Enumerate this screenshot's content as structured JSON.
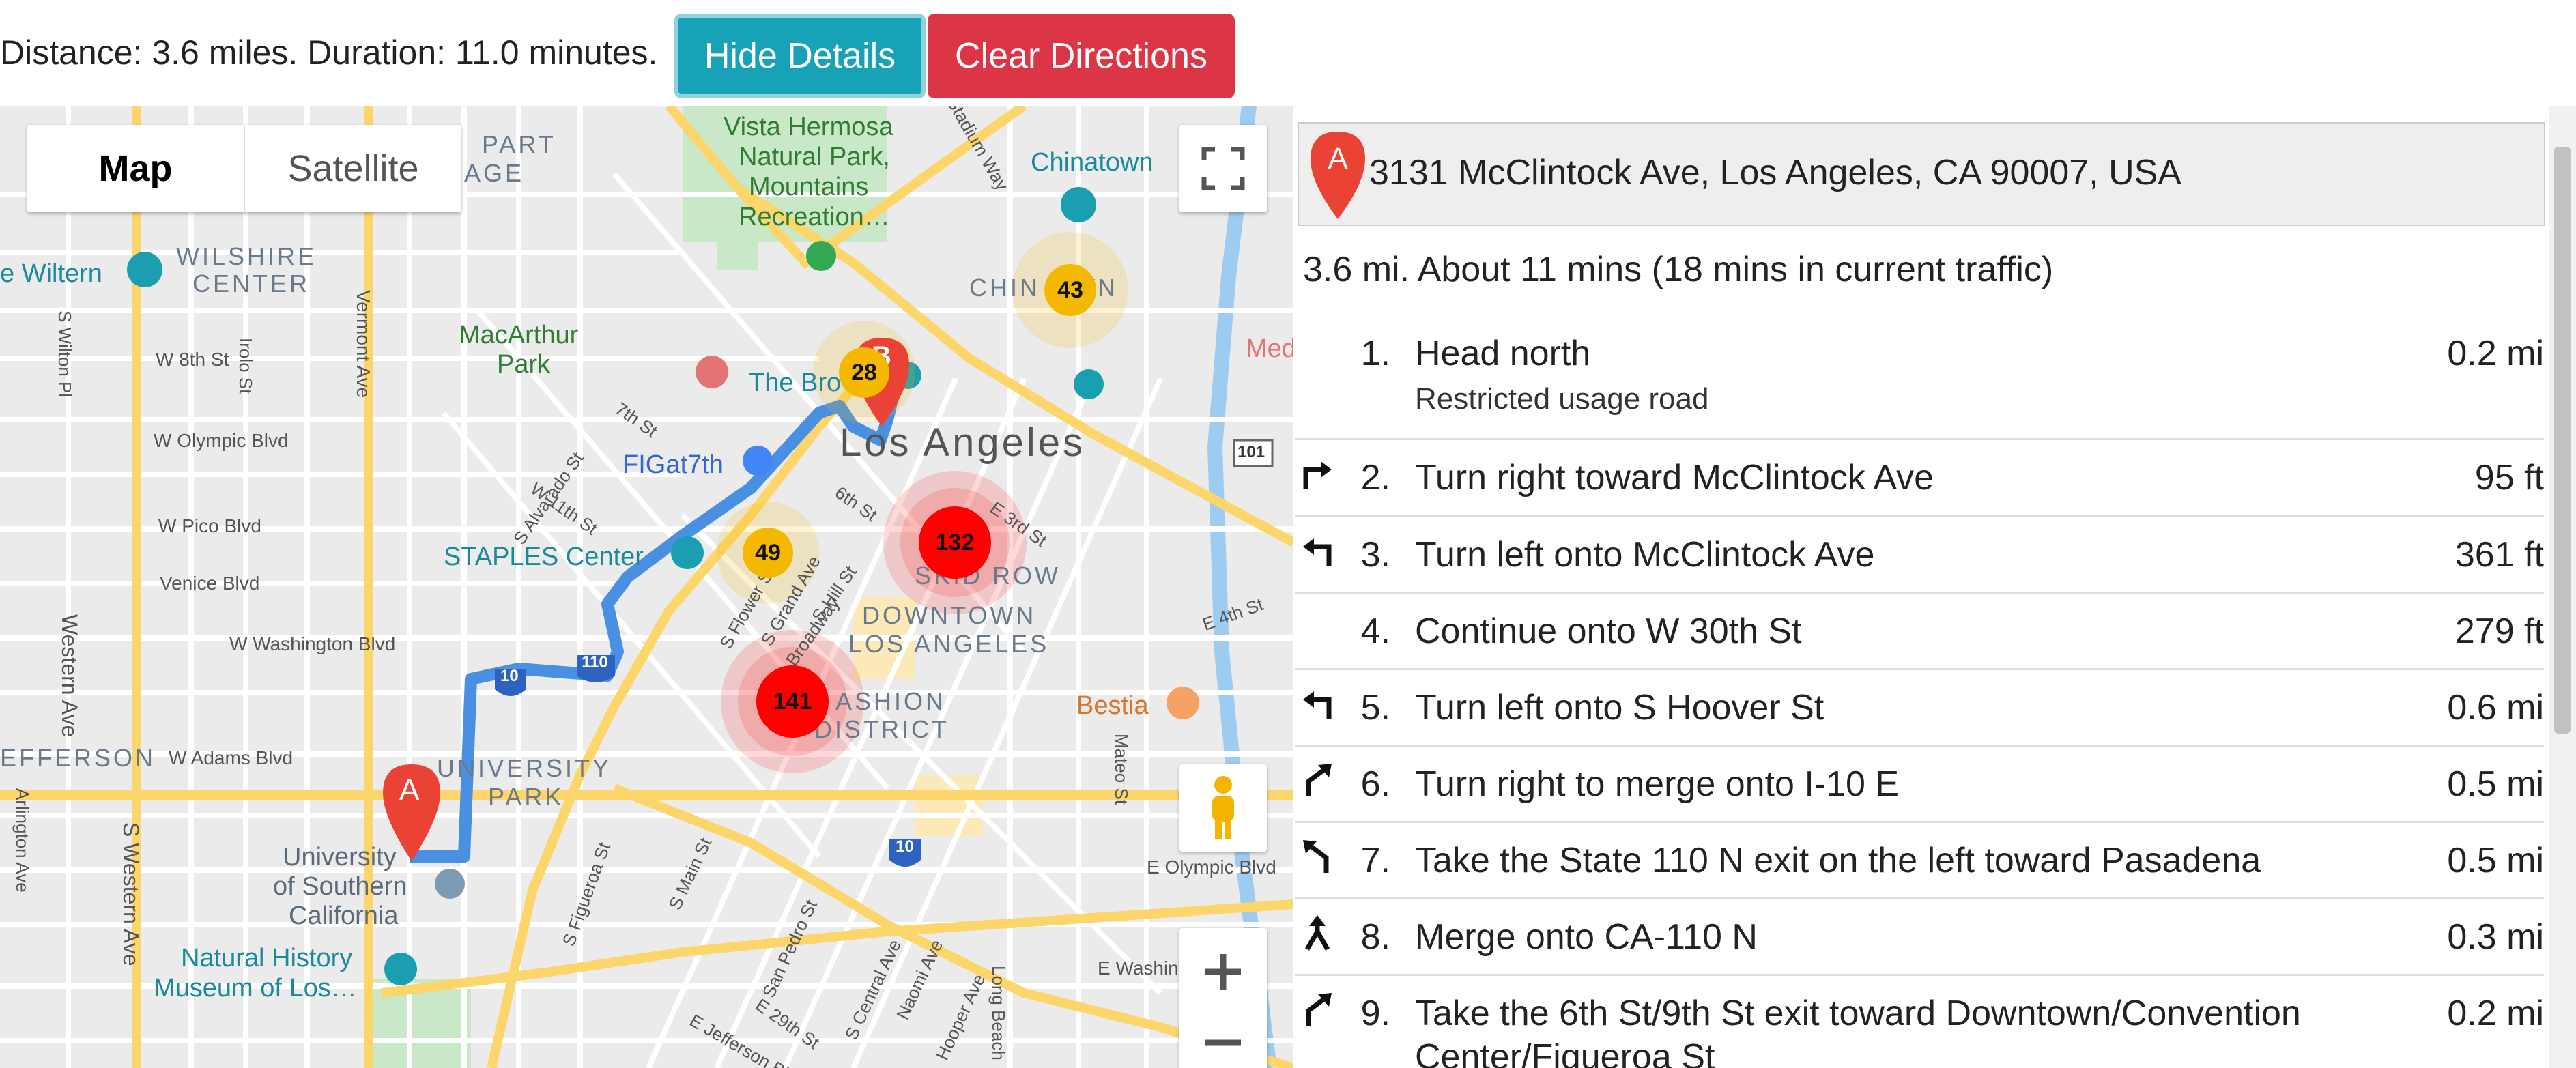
{
  "topbar": {
    "distance_text": "Distance: 3.6 miles. Duration: 11.0 minutes.",
    "hide_details_label": "Hide Details",
    "clear_directions_label": "Clear Directions"
  },
  "map": {
    "type_control": {
      "map_label": "Map",
      "satellite_label": "Satellite",
      "selected": "Map"
    },
    "labels": {
      "vista_hermosa": "Vista Hermosa",
      "natural_park": "Natural Park,",
      "mountains": "Mountains",
      "recreation": "Recreation…",
      "chinatown": "Chinatown",
      "chinatown_district": "CHIN      OWN",
      "wilshire_center_1": "WILSHIRE",
      "wilshire_center_2": "CENTER",
      "wiltern": "e Wiltern",
      "macarthur_1": "MacArthur",
      "macarthur_2": "Park",
      "the_broad": "The Bro",
      "los_angeles": "Los Angeles",
      "figat7th": "FIGat7th",
      "staples": "STAPLES Center",
      "skid_row": "SKID ROW",
      "downtown_1": "DOWNTOWN",
      "downtown_2": "LOS ANGELES",
      "fashion_1": "ASHION",
      "fashion_2": "DISTRICT",
      "bestia": "Bestia",
      "university_park_1": "UNIVERSITY",
      "university_park_2": "PARK",
      "jefferson": "EFFERSON",
      "usc_1": "University",
      "usc_2": "of Southern",
      "usc_3": "California",
      "nhm_1": "Natural History",
      "nhm_2": "Museum of Los…",
      "part_age_1": "PART",
      "part_age_2": "AGE",
      "med": "Med",
      "w_8th": "W 8th St",
      "w_olympic": "W Olympic Blvd",
      "w_pico": "W Pico Blvd",
      "venice": "Venice Blvd",
      "w_washington": "W Washington Blvd",
      "w_adams": "W Adams Blvd",
      "western_ave": "Western Ave",
      "s_western_ave": "S Western Ave",
      "vermont_ave": "Vermont Ave",
      "s_wilton": "S Wilton Pl",
      "irolo": "Irolo St",
      "arlington": "Arlington Ave",
      "e_olympic": "E Olympic Blvd",
      "e_washington": "E Washington Blvd",
      "e_4th": "E 4th St",
      "e_3rd": "E 3rd St",
      "sixth": "6th St",
      "seventh": "7th St",
      "s_alvarado": "S Alvarado St",
      "w_11th": "W 11th St",
      "s_hill": "S Hill St",
      "broadway": "Broadway",
      "s_main": "S Main St",
      "s_figueroa": "S Figueroa St",
      "san_pedro": "San Pedro St",
      "s_central": "S Central Ave",
      "naomi": "Naomi Ave",
      "hooper": "Hooper Ave",
      "mateo": "Mateo St",
      "long_beach": "Long Beach",
      "e_29th": "E 29th St",
      "e_jefferson": "E Jefferson Blvd",
      "stadium_way": "Stadium Way",
      "s_flower": "S Flower St",
      "s_grand": "S Grand Ave",
      "shield_10a": "10",
      "shield_10b": "10",
      "shield_110": "110",
      "shield_101": "101"
    },
    "clusters": [
      {
        "count": "43",
        "color": "#f5b800"
      },
      {
        "count": "28",
        "color": "#f5b800"
      },
      {
        "count": "49",
        "color": "#f5b800"
      },
      {
        "count": "132",
        "color": "#ff0000"
      },
      {
        "count": "141",
        "color": "#ff0000"
      }
    ],
    "marker_a_label": "A",
    "marker_b_label": "B",
    "route_color": "#4a90e2"
  },
  "directions": {
    "origin_marker_label": "A",
    "origin_address": "3131 McClintock Ave, Los Angeles, CA 90007, USA",
    "summary": "3.6 mi. About 11 mins (18 mins in current traffic)",
    "steps": [
      {
        "num": "1.",
        "text": "Head north",
        "sub": "Restricted usage road",
        "distance": "0.2 mi",
        "icon": "none"
      },
      {
        "num": "2.",
        "text": "Turn right toward McClintock Ave",
        "distance": "95 ft",
        "icon": "turn-right-icon"
      },
      {
        "num": "3.",
        "text": "Turn left onto McClintock Ave",
        "distance": "361 ft",
        "icon": "turn-left-icon"
      },
      {
        "num": "4.",
        "text": "Continue onto W 30th St",
        "distance": "279 ft",
        "icon": "none"
      },
      {
        "num": "5.",
        "text": "Turn left onto S Hoover St",
        "distance": "0.6 mi",
        "icon": "turn-left-icon"
      },
      {
        "num": "6.",
        "text": "Turn right to merge onto I-10 E",
        "distance": "0.5 mi",
        "icon": "ramp-right-icon"
      },
      {
        "num": "7.",
        "text": "Take the State 110 N exit on the left toward Pasadena",
        "distance": "0.5 mi",
        "icon": "ramp-left-icon"
      },
      {
        "num": "8.",
        "text": "Merge onto CA-110 N",
        "distance": "0.3 mi",
        "icon": "merge-icon"
      },
      {
        "num": "9.",
        "text": "Take the 6th St/9th St exit toward Downtown/Convention",
        "text2": "Center/Figueroa St",
        "distance": "0.2 mi",
        "icon": "ramp-right-icon"
      }
    ]
  }
}
